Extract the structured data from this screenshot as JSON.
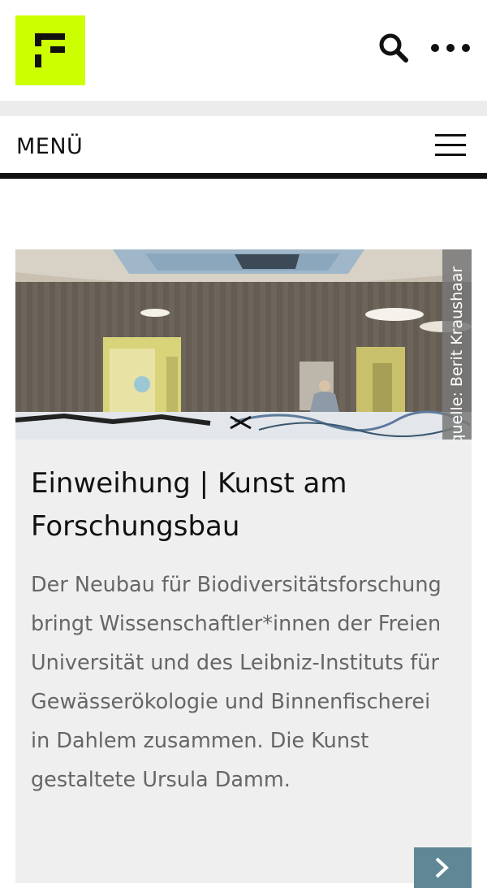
{
  "header": {
    "logo_alt": "Freie Universität Berlin",
    "search_icon": "search-icon",
    "more_icon": "more-horizontal-icon"
  },
  "menu": {
    "label": "MENÜ",
    "icon": "hamburger-icon"
  },
  "article": {
    "image_credit": "Bildquelle: Berit Kraushaar",
    "title": "Einweihung | Kunst am Forschungsbau",
    "teaser": "Der Neubau für Biodiversitätsforschung bringt Wissenschaftler*innen der Freien Universität und des Leibniz-Instituts für Gewässerökologie und Binnenfischerei in Dahlem zusammen. Die Kunst gestaltete Ursula Damm.",
    "next_icon": "chevron-right-icon"
  },
  "colors": {
    "logo_bg": "#ccff00",
    "card_bg": "#efefef",
    "teaser_text": "#666666",
    "next_button": "#5f8795"
  }
}
